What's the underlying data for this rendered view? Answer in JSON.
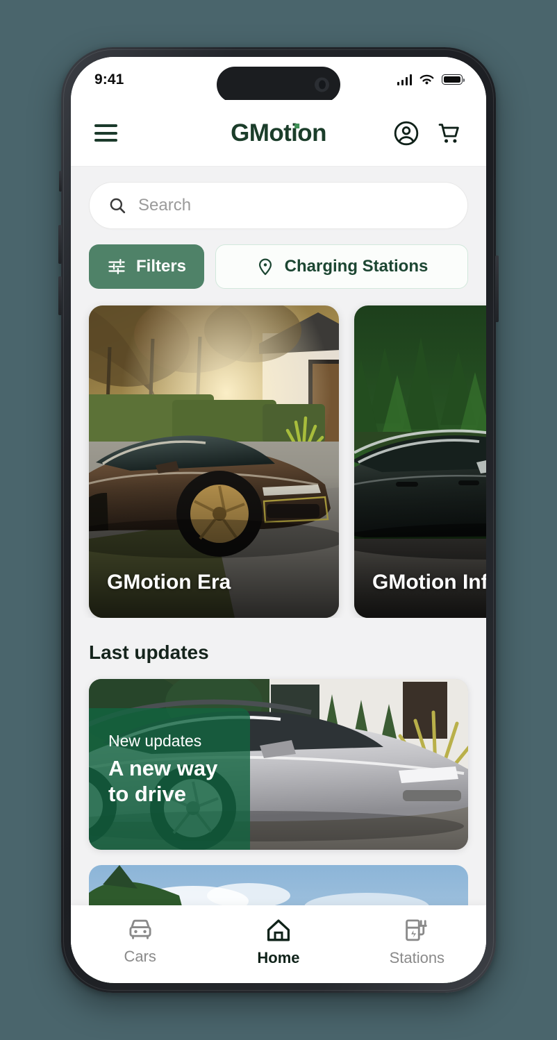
{
  "status_bar": {
    "time": "9:41",
    "cellular_icon": "signal-bars-icon",
    "wifi_icon": "wifi-icon",
    "battery_icon": "battery-icon"
  },
  "header": {
    "menu_icon": "hamburger-menu-icon",
    "brand": "GMotion",
    "account_icon": "account-circle-icon",
    "cart_icon": "shopping-cart-icon"
  },
  "search": {
    "placeholder": "Search",
    "value": "",
    "icon": "search-icon"
  },
  "filters": {
    "filters_label": "Filters",
    "filters_icon": "sliders-icon",
    "stations_label": "Charging Stations",
    "stations_icon": "map-pin-icon"
  },
  "cars": [
    {
      "name": "GMotion Era"
    },
    {
      "name": "GMotion Infiniti"
    }
  ],
  "last_updates": {
    "heading": "Last updates",
    "promo": {
      "kicker": "New updates",
      "headline_line1": "A new way",
      "headline_line2": "to drive"
    }
  },
  "bottom_nav": [
    {
      "label": "Cars",
      "icon": "car-icon",
      "active": false
    },
    {
      "label": "Home",
      "icon": "home-icon",
      "active": true
    },
    {
      "label": "Stations",
      "icon": "charging-station-icon",
      "active": false
    }
  ],
  "colors": {
    "background": "#4a656c",
    "brand_green": "#1b3d2a",
    "accent_green": "#4f8268",
    "promo_green": "#116440",
    "surface": "#f2f2f3"
  }
}
